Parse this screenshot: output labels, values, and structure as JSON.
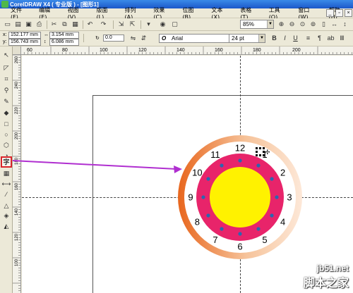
{
  "window": {
    "title": "CorelDRAW X4 ( 专业版 ) - [图形1]"
  },
  "menu": [
    "文件(F)",
    "编辑(E)",
    "视图(V)",
    "版面(L)",
    "排列(A)",
    "效果(C)",
    "位图(B)",
    "文本(X)",
    "表格(T)",
    "工具(O)",
    "窗口(W)",
    "帮助(H)"
  ],
  "toolbar": {
    "zoom": "85%"
  },
  "property_bar": {
    "x": "152.177 mm",
    "y": "156.743 mm",
    "width": "3.154 mm",
    "height": "6.086 mm",
    "rotation": "0.0",
    "font": "Arial",
    "font_size": "24 pt"
  },
  "ruler_top": [
    "60",
    "80",
    "100",
    "120",
    "140",
    "160",
    "180",
    "200"
  ],
  "ruler_left": [
    "260",
    "240",
    "220",
    "200",
    "180",
    "160",
    "140",
    "120",
    "100"
  ],
  "clock": {
    "numbers": [
      "12",
      "1",
      "2",
      "3",
      "4",
      "5",
      "6",
      "7",
      "8",
      "9",
      "10",
      "11"
    ]
  },
  "colors": {
    "pink": "#e8246a",
    "yellow": "#fff200",
    "outer_ring": "#e87a2e",
    "dots": "#2a66b0",
    "arrow": "#b02fd0",
    "highlight": "#d9252a"
  },
  "watermark": {
    "line1": "jb51.net",
    "line2": "脚本之家"
  },
  "icons": [
    "pick-tool-icon",
    "shape-tool-icon",
    "crop-tool-icon",
    "zoom-tool-icon",
    "freehand-tool-icon",
    "smart-fill-icon",
    "rectangle-tool-icon",
    "ellipse-tool-icon",
    "polygon-tool-icon",
    "basic-shapes-icon",
    "text-tool-icon",
    "table-tool-icon",
    "parallel-dimension-icon",
    "eyedropper-icon",
    "outline-pen-icon",
    "fill-tool-icon",
    "interactive-fill-icon"
  ]
}
